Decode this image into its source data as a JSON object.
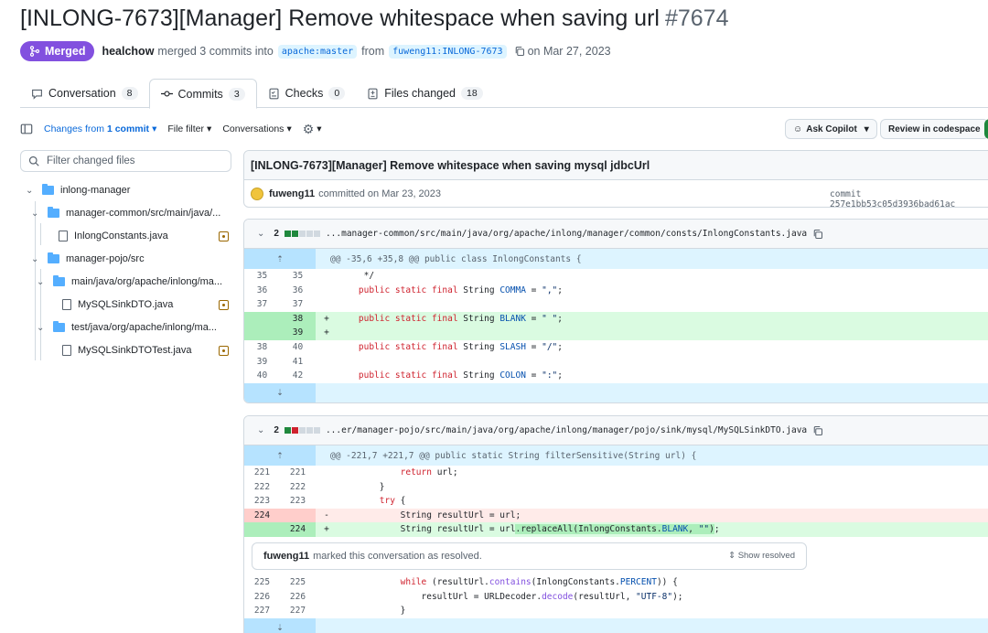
{
  "pr": {
    "title": "[INLONG-7673][Manager] Remove whitespace when saving url",
    "number": "#7674",
    "state": "Merged",
    "author": "healchow",
    "merge_text": "merged 3 commits into",
    "base_branch": "apache:master",
    "from_text": "from",
    "head_branch": "fuweng11:INLONG-7673",
    "date_text": "on Mar 27, 2023"
  },
  "tabs": [
    {
      "label": "Conversation",
      "count": "8"
    },
    {
      "label": "Commits",
      "count": "3"
    },
    {
      "label": "Checks",
      "count": "0"
    },
    {
      "label": "Files changed",
      "count": "18"
    }
  ],
  "toolbar": {
    "changes_prefix": "Changes from",
    "changes_value": "1 commit",
    "file_filter": "File filter",
    "conversations": "Conversations",
    "ask_copilot": "Ask Copilot",
    "review_codespace": "Review in codespace"
  },
  "sidebar": {
    "filter_placeholder": "Filter changed files",
    "tree": [
      {
        "label": "inlong-manager",
        "type": "folder"
      },
      {
        "label": "manager-common/src/main/java/...",
        "type": "folder"
      },
      {
        "label": "InlongConstants.java",
        "type": "file"
      },
      {
        "label": "manager-pojo/src",
        "type": "folder"
      },
      {
        "label": "main/java/org/apache/inlong/ma...",
        "type": "folder"
      },
      {
        "label": "MySQLSinkDTO.java",
        "type": "file"
      },
      {
        "label": "test/java/org/apache/inlong/ma...",
        "type": "folder"
      },
      {
        "label": "MySQLSinkDTOTest.java",
        "type": "file"
      }
    ]
  },
  "commit": {
    "message": "[INLONG-7673][Manager] Remove whitespace when saving mysql jdbcUrl",
    "author": "fuweng11",
    "committed_text": "committed on Mar 23, 2023",
    "sha_text": "commit 257e1bb53c05d3936bad61ac"
  },
  "files": [
    {
      "change_count": "2",
      "path": "...manager-common/src/main/java/org/apache/inlong/manager/common/consts/InlongConstants.java",
      "hunk": "@@ -35,6 +35,8 @@ public class InlongConstants {"
    },
    {
      "change_count": "2",
      "path": "...er/manager-pojo/src/main/java/org/apache/inlong/manager/pojo/sink/mysql/MySQLSinkDTO.java",
      "hunk": "@@ -221,7 +221,7 @@ public static String filterSensitive(String url) {"
    }
  ],
  "resolved": {
    "author": "fuweng11",
    "text": "marked this conversation as resolved.",
    "show": "Show resolved"
  },
  "colors": {
    "merged": "#8250df",
    "add_bg": "#dafbe1",
    "del_bg": "#ffebe9",
    "hunk_bg": "#ddf4ff"
  }
}
